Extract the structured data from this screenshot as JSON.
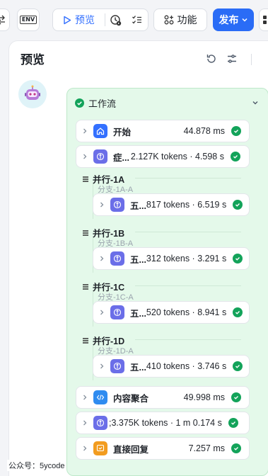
{
  "toolbar": {
    "env_label": "ENV",
    "preview_label": "预览",
    "function_label": "功能",
    "publish_label": "发布"
  },
  "panel": {
    "title": "预览"
  },
  "workflow": {
    "title": "工作流",
    "nodes": [
      {
        "name": "开始",
        "stats": "44.878 ms",
        "icon": "home-icon",
        "color": "#3370ff"
      },
      {
        "name": "症...",
        "stats": "2.127K tokens · 4.598 s",
        "icon": "llm-icon",
        "color": "#6b6ee8"
      }
    ],
    "parallels": [
      {
        "title": "并行-1A",
        "branch": "分支-1A-A",
        "node_name": "五...",
        "node_stats": "817 tokens · 6.519 s"
      },
      {
        "title": "并行-1B",
        "branch": "分支-1B-A",
        "node_name": "五...",
        "node_stats": "312 tokens · 3.291 s"
      },
      {
        "title": "并行-1C",
        "branch": "分支-1C-A",
        "node_name": "五...",
        "node_stats": "520 tokens · 8.941 s"
      },
      {
        "title": "并行-1D",
        "branch": "分支-1D-A",
        "node_name": "五...",
        "node_stats": "410 tokens · 3.746 s"
      }
    ],
    "tail_nodes": [
      {
        "name": "内容聚合",
        "stats": "49.998 ms",
        "icon": "code-icon",
        "color": "#2f8cf0"
      },
      {
        "name": "",
        "stats": ";3.375K tokens · 1 m 0.174 s",
        "icon": "llm-icon",
        "color": "#6b6ee8"
      },
      {
        "name": "直接回复",
        "stats": "7.257 ms",
        "icon": "reply-icon",
        "color": "#f29c1f"
      }
    ]
  },
  "watermark": "公众号：5ycode"
}
